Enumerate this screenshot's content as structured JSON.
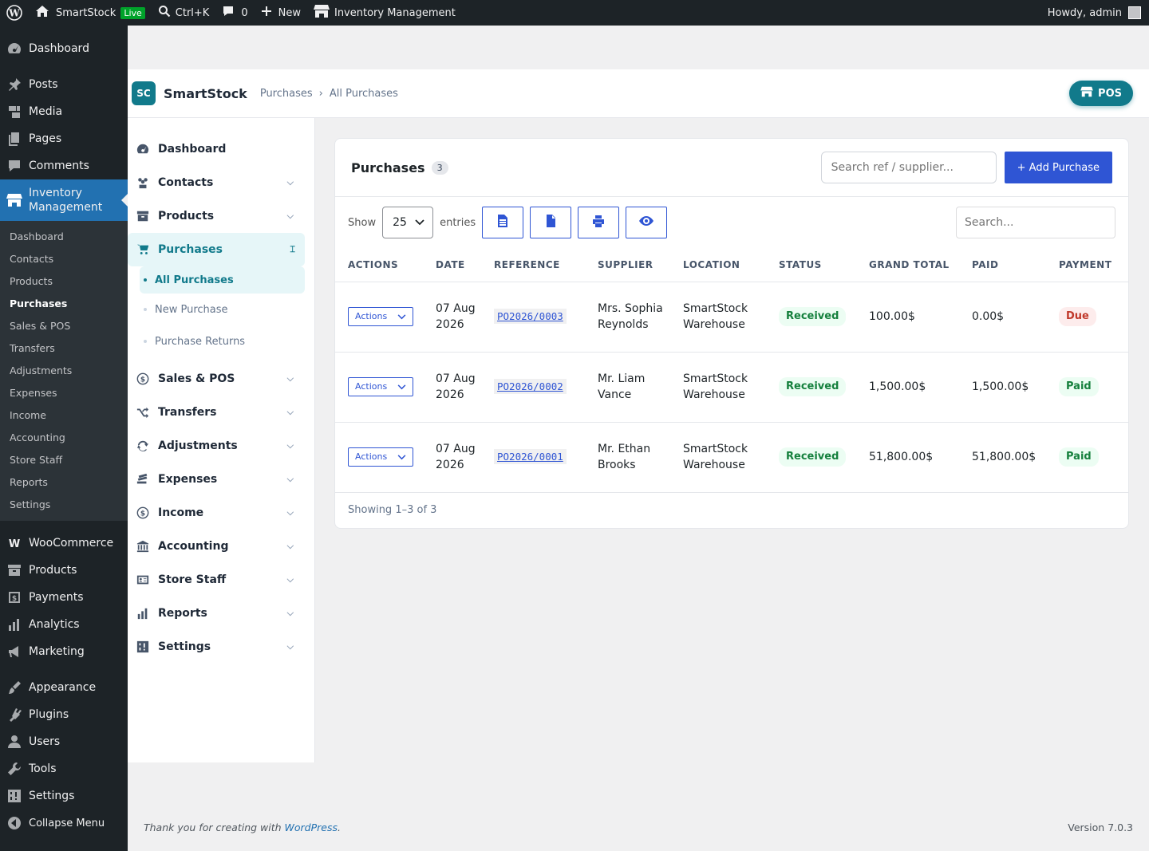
{
  "adminbar": {
    "site_name": "SmartStock",
    "live": "Live",
    "shortcut": "Ctrl+K",
    "comments": "0",
    "new": "New",
    "plugin": "Inventory Management",
    "howdy": "Howdy, admin"
  },
  "wp_menu": {
    "dashboard": "Dashboard",
    "posts": "Posts",
    "media": "Media",
    "pages": "Pages",
    "comments": "Comments",
    "inventory": "Inventory Management",
    "submenu": [
      "Dashboard",
      "Contacts",
      "Products",
      "Purchases",
      "Sales & POS",
      "Transfers",
      "Adjustments",
      "Expenses",
      "Income",
      "Accounting",
      "Store Staff",
      "Reports",
      "Settings"
    ],
    "woocommerce": "WooCommerce",
    "products": "Products",
    "payments": "Payments",
    "analytics": "Analytics",
    "marketing": "Marketing",
    "appearance": "Appearance",
    "plugins": "Plugins",
    "users": "Users",
    "tools": "Tools",
    "settings": "Settings",
    "collapse": "Collapse Menu"
  },
  "header": {
    "logo": "SC",
    "brand": "SmartStock",
    "crumb1": "Purchases",
    "crumb_sep": "›",
    "crumb2": "All Purchases",
    "pos": "POS"
  },
  "nav": {
    "dashboard": "Dashboard",
    "contacts": "Contacts",
    "products": "Products",
    "purchases": "Purchases",
    "purchases_sub": [
      "All Purchases",
      "New Purchase",
      "Purchase Returns"
    ],
    "sales": "Sales & POS",
    "transfers": "Transfers",
    "adjustments": "Adjustments",
    "expenses": "Expenses",
    "income": "Income",
    "accounting": "Accounting",
    "staff": "Store Staff",
    "reports": "Reports",
    "settings": "Settings"
  },
  "card": {
    "title": "Purchases",
    "count": "3",
    "search_placeholder": "Search ref / supplier...",
    "add_label": "+ Add Purchase",
    "show": "Show",
    "entries_value": "25",
    "entries": "entries",
    "table_search_placeholder": "Search...",
    "columns": [
      "ACTIONS",
      "DATE",
      "REFERENCE",
      "SUPPLIER",
      "LOCATION",
      "STATUS",
      "GRAND TOTAL",
      "PAID",
      "PAYMENT"
    ],
    "rows": [
      {
        "action": "Actions",
        "date": "07 Aug 2026",
        "ref": "PO2026/0003",
        "supplier": "Mrs. Sophia Reynolds",
        "location": "SmartStock Warehouse",
        "status": "Received",
        "total": "100.00$",
        "paid": "0.00$",
        "payment": "Due"
      },
      {
        "action": "Actions",
        "date": "07 Aug 2026",
        "ref": "PO2026/0002",
        "supplier": "Mr. Liam Vance",
        "location": "SmartStock Warehouse",
        "status": "Received",
        "total": "1,500.00$",
        "paid": "1,500.00$",
        "payment": "Paid"
      },
      {
        "action": "Actions",
        "date": "07 Aug 2026",
        "ref": "PO2026/0001",
        "supplier": "Mr. Ethan Brooks",
        "location": "SmartStock Warehouse",
        "status": "Received",
        "total": "51,800.00$",
        "paid": "51,800.00$",
        "payment": "Paid"
      }
    ],
    "footer": "Showing 1–3 of 3"
  },
  "footer": {
    "thanks": "Thank you for creating with",
    "wp_link": "WordPress",
    "period": ".",
    "version": "Version 7.0.3"
  },
  "colors": {
    "accent": "#117a8b",
    "primary": "#2f55d4",
    "admin_bg": "#1d2327",
    "wp_blue": "#2271b1"
  }
}
